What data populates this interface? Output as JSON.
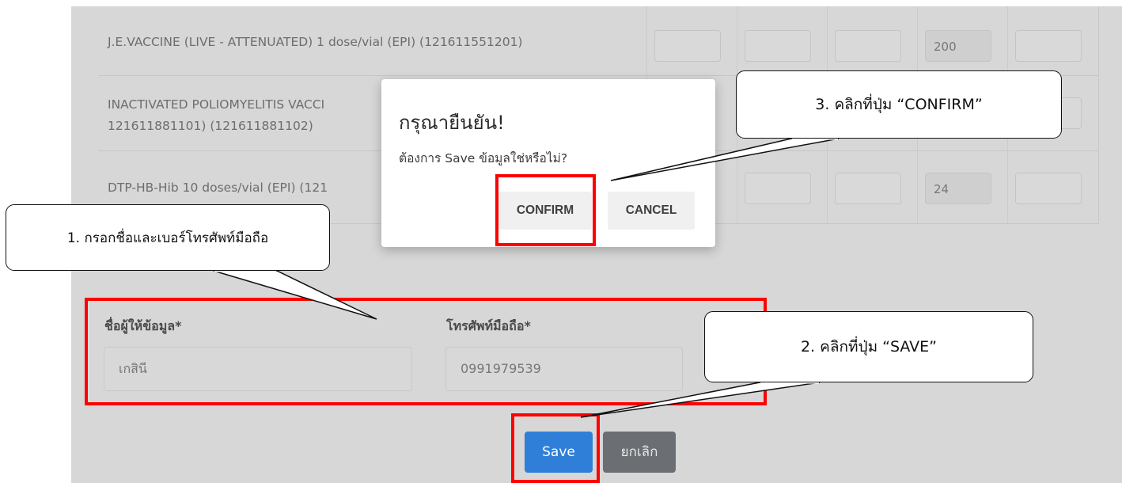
{
  "table": {
    "rows": [
      {
        "name": "J.E.VACCINE (LIVE - ATTENUATED) 1 dose/vial (EPI) (121611551201)",
        "filled_value": "200"
      },
      {
        "name_line1": "INACTIVATED POLIOMYELITIS VACCI",
        "name_line2": "121611881101) (121611881102)"
      },
      {
        "name": "DTP-HB-Hib 10 doses/vial (EPI) (121",
        "filled_value": "24"
      }
    ]
  },
  "dialog": {
    "title": "กรุณายืนยัน!",
    "message": "ต้องการ Save ข้อมูลใช่หรือไม่?",
    "confirm_label": "CONFIRM",
    "cancel_label": "CANCEL"
  },
  "form": {
    "name_label": "ชื่อผู้ให้ข้อมูล*",
    "name_value": "เกสินี",
    "phone_label": "โทรศัพท์มือถือ*",
    "phone_value": "0991979539"
  },
  "buttons": {
    "save_label": "Save",
    "cancel_label": "ยกเลิก"
  },
  "callouts": {
    "step1": "1. กรอกชื่อและเบอร์โทรศัพท์มือถือ",
    "step2": "2. คลิกที่ปุ่ม “SAVE”",
    "step3": "3. คลิกที่ปุ่ม “CONFIRM”"
  },
  "colors": {
    "highlight": "#ff0000",
    "save_button": "#2f7fd8",
    "cancel_button": "#6b6f73"
  }
}
